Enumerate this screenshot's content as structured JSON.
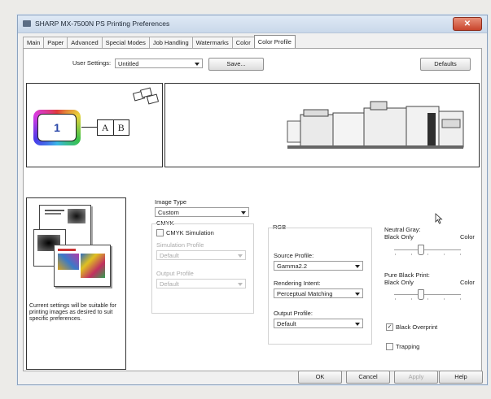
{
  "window": {
    "title": "SHARP MX-7500N PS Printing Preferences",
    "close_label": "✕"
  },
  "tabs": [
    "Main",
    "Paper",
    "Advanced",
    "Special Modes",
    "Job Handling",
    "Watermarks",
    "Color",
    "Color Profile"
  ],
  "header": {
    "user_settings_label": "User Settings:",
    "user_settings_value": "Untitled",
    "save_label": "Save...",
    "defaults_label": "Defaults"
  },
  "preview": {
    "copies_number": "1",
    "page_a": "A",
    "page_b": "B",
    "info_text": "Current settings will be suitable for printing images as desired to suit specific preferences."
  },
  "image_type": {
    "label": "Image Type",
    "value": "Custom"
  },
  "cmyk": {
    "group_label": "CMYK",
    "simulation_label": "CMYK Simulation",
    "simulation_checked": false,
    "simulation_profile_label": "Simulation Profile",
    "simulation_profile_value": "Default",
    "output_profile_label": "Output Profile",
    "output_profile_value": "Default"
  },
  "rgb": {
    "group_label": "RGB",
    "source_profile_label": "Source Profile:",
    "source_profile_value": "Gamma2.2",
    "rendering_intent_label": "Rendering Intent:",
    "rendering_intent_value": "Perceptual Matching",
    "output_profile_label": "Output Profile:",
    "output_profile_value": "Default"
  },
  "neutral_gray": {
    "label": "Neutral Gray:",
    "left": "Black Only",
    "right": "Color"
  },
  "pure_black_print": {
    "label": "Pure Black Print:",
    "left": "Black Only",
    "right": "Color"
  },
  "options": {
    "black_overprint_label": "Black Overprint",
    "black_overprint_checked": true,
    "trapping_label": "Trapping",
    "trapping_checked": false
  },
  "footer": {
    "ok_label": "OK",
    "cancel_label": "Cancel",
    "apply_label": "Apply",
    "help_label": "Help"
  }
}
